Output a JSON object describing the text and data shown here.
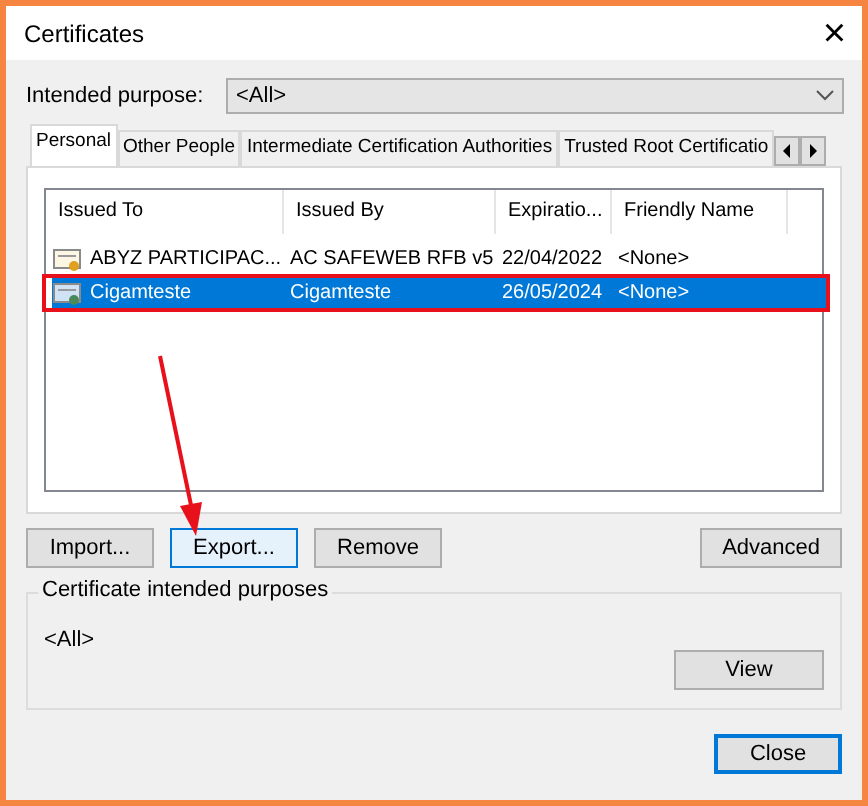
{
  "window": {
    "title": "Certificates",
    "close": "×"
  },
  "purpose": {
    "label": "Intended purpose:",
    "value": "<All>"
  },
  "tabs": [
    {
      "label": "Personal",
      "selected": true
    },
    {
      "label": "Other People",
      "selected": false
    },
    {
      "label": "Intermediate Certification Authorities",
      "selected": false
    },
    {
      "label": "Trusted Root Certificatio",
      "selected": false
    }
  ],
  "table": {
    "columns": [
      "Issued To",
      "Issued By",
      "Expiratio...",
      "Friendly Name"
    ],
    "rows": [
      {
        "cells": [
          "ABYZ PARTICIPAC...",
          "AC SAFEWEB RFB v5",
          "22/04/2022",
          "<None>"
        ],
        "selected": false,
        "highlighted": false
      },
      {
        "cells": [
          "Cigamteste",
          "Cigamteste",
          "26/05/2024",
          "<None>"
        ],
        "selected": true,
        "highlighted": true
      }
    ]
  },
  "buttons": [
    {
      "label": "Import...",
      "focused": false
    },
    {
      "label": "Export...",
      "focused": true
    },
    {
      "label": "Remove",
      "focused": false
    },
    {
      "label": "Advanced",
      "focused": false
    }
  ],
  "purposes_group": {
    "title": "Certificate intended purposes",
    "value": "<All>",
    "button": "View"
  },
  "close_button": {
    "label": "Close",
    "default": true
  }
}
